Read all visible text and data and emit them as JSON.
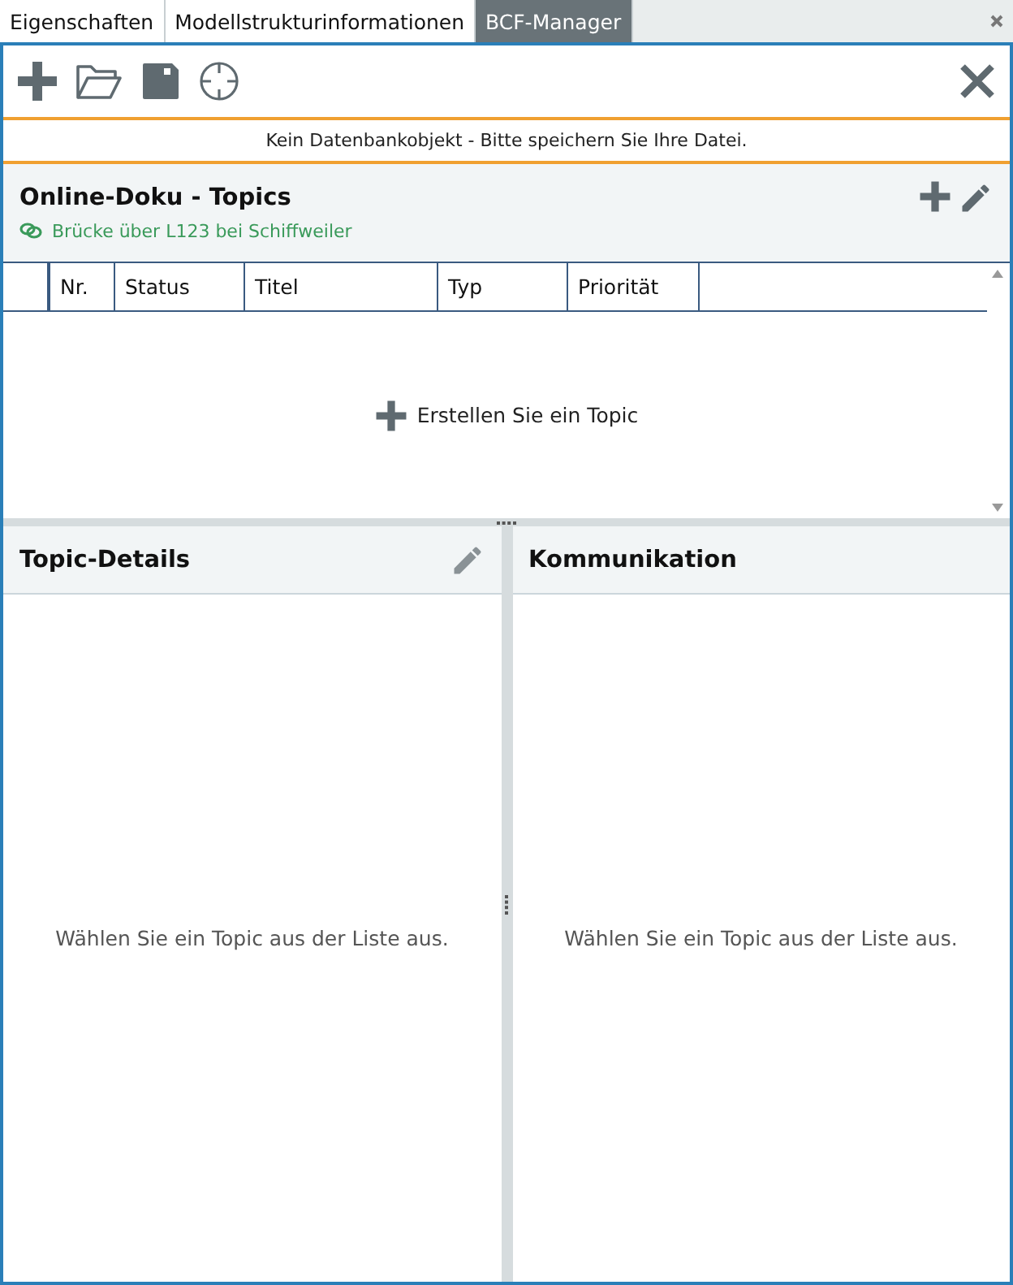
{
  "tabs": [
    {
      "label": "Eigenschaften",
      "selected": false
    },
    {
      "label": "Modellstrukturinformationen",
      "selected": false
    },
    {
      "label": "BCF-Manager",
      "selected": true
    }
  ],
  "notice": "Kein Datenbankobjekt - Bitte speichern Sie Ihre Datei.",
  "topics": {
    "title": "Online-Doku - Topics",
    "project": "Brücke über L123 bei Schiffweiler",
    "columns": [
      "Nr.",
      "Status",
      "Titel",
      "Typ",
      "Priorität"
    ],
    "create_label": "Erstellen Sie ein Topic"
  },
  "details": {
    "title": "Topic-Details",
    "empty_text": "Wählen Sie ein Topic aus der Liste aus."
  },
  "communication": {
    "title": "Kommunikation",
    "empty_text": "Wählen Sie ein Topic aus der Liste aus."
  }
}
